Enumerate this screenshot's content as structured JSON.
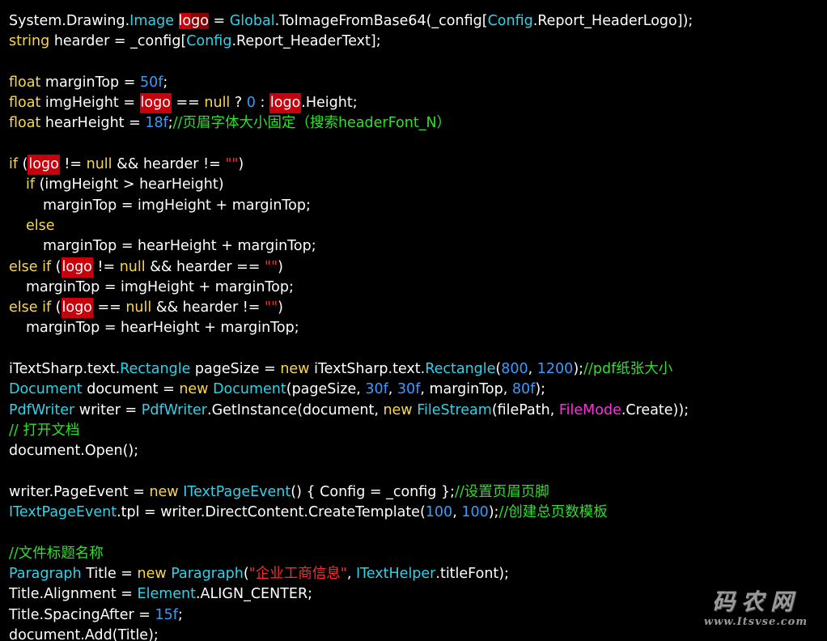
{
  "editor": {
    "theme": {
      "background": "#000000",
      "plain": "#ffffff",
      "keyword": "#f8d84a",
      "type": "#2fd2e8",
      "number": "#3a9bff",
      "comment": "#2de02d",
      "string": "#ff2a2a",
      "enum_type": "#ff2ee6",
      "highlight": "#c8000b"
    },
    "code": {
      "l01": [
        "System.Drawing.",
        "Image",
        " ",
        "lo",
        "go",
        " = ",
        "Global",
        ".ToImageFromBase64(_config[",
        "Config",
        ".Report_HeaderLogo]);"
      ],
      "l02": [
        "string",
        " hearder = _config[",
        "Config",
        ".Report_HeaderText];"
      ],
      "l04": [
        "float",
        " marginTop = ",
        "50f",
        ";"
      ],
      "l05": [
        "float",
        " imgHeight = ",
        "logo",
        " == ",
        "null",
        " ? ",
        "0",
        " : ",
        "logo",
        ".Height;"
      ],
      "l06": [
        "float",
        " hearHeight = ",
        "18f",
        ";",
        "//页眉字体大小固定（搜索headerFont_N）"
      ],
      "l08": [
        "if",
        " (",
        "logo",
        " != ",
        "null",
        " && hearder != ",
        "\"\"",
        ")"
      ],
      "l09": [
        "if",
        " (imgHeight > hearHeight)"
      ],
      "l10": [
        "marginTop = imgHeight + marginTop;"
      ],
      "l11": [
        "else"
      ],
      "l12": [
        "marginTop = hearHeight + marginTop;"
      ],
      "l13": [
        "else if",
        " (",
        "logo",
        " != ",
        "null",
        " && hearder == ",
        "\"\"",
        ")"
      ],
      "l14": [
        "marginTop = imgHeight + marginTop;"
      ],
      "l15": [
        "else if",
        " (",
        "logo",
        " == ",
        "null",
        " && hearder != ",
        "\"\"",
        ")"
      ],
      "l16": [
        "marginTop = hearHeight + marginTop;"
      ],
      "l18": [
        "iTextSharp.text.",
        "Rectangle",
        " pageSize = ",
        "new",
        " iTextSharp.text.",
        "Rectangle",
        "(",
        "800",
        ", ",
        "1200",
        ");",
        "//pdf纸张大小"
      ],
      "l19": [
        "Document",
        " document = ",
        "new",
        " ",
        "Document",
        "(pageSize, ",
        "30f",
        ", ",
        "30f",
        ", marginTop, ",
        "80f",
        ");"
      ],
      "l20": [
        "PdfWriter",
        " writer = ",
        "PdfWriter",
        ".GetInstance(document, ",
        "new",
        " ",
        "FileStream",
        "(filePath, ",
        "FileMode",
        ".Create));"
      ],
      "l21": [
        "// 打开文档"
      ],
      "l22": [
        "document.Open();"
      ],
      "l24": [
        "writer.PageEvent = ",
        "new",
        " ",
        "ITextPageEvent",
        "() { Config = _config };",
        "//设置页眉页脚"
      ],
      "l25": [
        "ITextPageEvent",
        ".tpl = writer.DirectContent.CreateTemplate(",
        "100",
        ", ",
        "100",
        ");",
        "//创建总页数模板"
      ],
      "l27": [
        "//文件标题名称"
      ],
      "l28": [
        "Paragraph",
        " Title = ",
        "new",
        " ",
        "Paragraph",
        "(",
        "\"企业工商信息\"",
        ", ",
        "ITextHelper",
        ".titleFont);"
      ],
      "l29": [
        "Title.Alignment = ",
        "Element",
        ".ALIGN_CENTER;"
      ],
      "l30": [
        "Title.SpacingAfter = ",
        "15f",
        ";"
      ],
      "l31": [
        "document.Add(Title);"
      ]
    }
  },
  "watermark": {
    "brand": "码农网",
    "url": "www.Itsvse.com"
  }
}
